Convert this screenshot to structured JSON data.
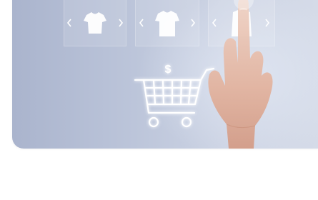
{
  "image": {
    "subject": "hand-touching-virtual-shopping-cart",
    "icons": [
      "tshirt-icon",
      "tshirt-icon",
      "tshirt-icon",
      "dollar-icon",
      "shopping-cart-icon",
      "chevron-left-icon",
      "chevron-right-icon"
    ],
    "colors": {
      "background": "#bcc5da",
      "glow": "#ffffff",
      "skin": "#e4b7a2",
      "page": "#ffffff"
    }
  },
  "cart": {
    "currency_symbol": "$"
  }
}
